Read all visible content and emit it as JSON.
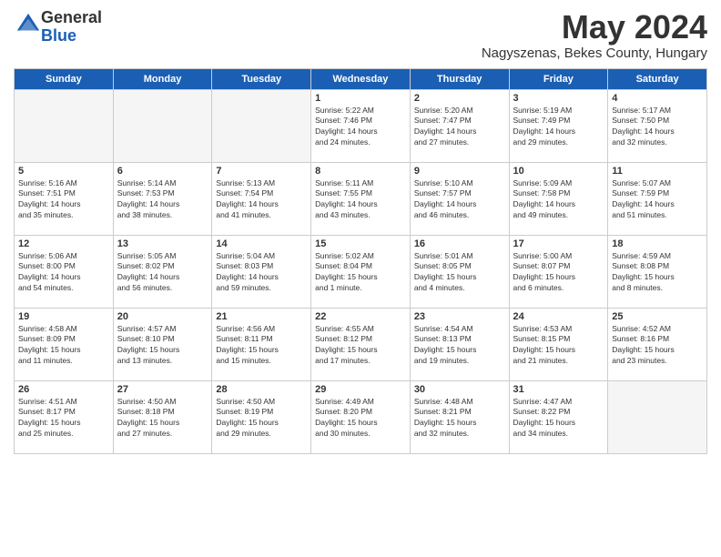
{
  "logo": {
    "general": "General",
    "blue": "Blue"
  },
  "header": {
    "month": "May 2024",
    "location": "Nagyszenas, Bekes County, Hungary"
  },
  "weekdays": [
    "Sunday",
    "Monday",
    "Tuesday",
    "Wednesday",
    "Thursday",
    "Friday",
    "Saturday"
  ],
  "weeks": [
    [
      {
        "day": "",
        "info": ""
      },
      {
        "day": "",
        "info": ""
      },
      {
        "day": "",
        "info": ""
      },
      {
        "day": "1",
        "info": "Sunrise: 5:22 AM\nSunset: 7:46 PM\nDaylight: 14 hours\nand 24 minutes."
      },
      {
        "day": "2",
        "info": "Sunrise: 5:20 AM\nSunset: 7:47 PM\nDaylight: 14 hours\nand 27 minutes."
      },
      {
        "day": "3",
        "info": "Sunrise: 5:19 AM\nSunset: 7:49 PM\nDaylight: 14 hours\nand 29 minutes."
      },
      {
        "day": "4",
        "info": "Sunrise: 5:17 AM\nSunset: 7:50 PM\nDaylight: 14 hours\nand 32 minutes."
      }
    ],
    [
      {
        "day": "5",
        "info": "Sunrise: 5:16 AM\nSunset: 7:51 PM\nDaylight: 14 hours\nand 35 minutes."
      },
      {
        "day": "6",
        "info": "Sunrise: 5:14 AM\nSunset: 7:53 PM\nDaylight: 14 hours\nand 38 minutes."
      },
      {
        "day": "7",
        "info": "Sunrise: 5:13 AM\nSunset: 7:54 PM\nDaylight: 14 hours\nand 41 minutes."
      },
      {
        "day": "8",
        "info": "Sunrise: 5:11 AM\nSunset: 7:55 PM\nDaylight: 14 hours\nand 43 minutes."
      },
      {
        "day": "9",
        "info": "Sunrise: 5:10 AM\nSunset: 7:57 PM\nDaylight: 14 hours\nand 46 minutes."
      },
      {
        "day": "10",
        "info": "Sunrise: 5:09 AM\nSunset: 7:58 PM\nDaylight: 14 hours\nand 49 minutes."
      },
      {
        "day": "11",
        "info": "Sunrise: 5:07 AM\nSunset: 7:59 PM\nDaylight: 14 hours\nand 51 minutes."
      }
    ],
    [
      {
        "day": "12",
        "info": "Sunrise: 5:06 AM\nSunset: 8:00 PM\nDaylight: 14 hours\nand 54 minutes."
      },
      {
        "day": "13",
        "info": "Sunrise: 5:05 AM\nSunset: 8:02 PM\nDaylight: 14 hours\nand 56 minutes."
      },
      {
        "day": "14",
        "info": "Sunrise: 5:04 AM\nSunset: 8:03 PM\nDaylight: 14 hours\nand 59 minutes."
      },
      {
        "day": "15",
        "info": "Sunrise: 5:02 AM\nSunset: 8:04 PM\nDaylight: 15 hours\nand 1 minute."
      },
      {
        "day": "16",
        "info": "Sunrise: 5:01 AM\nSunset: 8:05 PM\nDaylight: 15 hours\nand 4 minutes."
      },
      {
        "day": "17",
        "info": "Sunrise: 5:00 AM\nSunset: 8:07 PM\nDaylight: 15 hours\nand 6 minutes."
      },
      {
        "day": "18",
        "info": "Sunrise: 4:59 AM\nSunset: 8:08 PM\nDaylight: 15 hours\nand 8 minutes."
      }
    ],
    [
      {
        "day": "19",
        "info": "Sunrise: 4:58 AM\nSunset: 8:09 PM\nDaylight: 15 hours\nand 11 minutes."
      },
      {
        "day": "20",
        "info": "Sunrise: 4:57 AM\nSunset: 8:10 PM\nDaylight: 15 hours\nand 13 minutes."
      },
      {
        "day": "21",
        "info": "Sunrise: 4:56 AM\nSunset: 8:11 PM\nDaylight: 15 hours\nand 15 minutes."
      },
      {
        "day": "22",
        "info": "Sunrise: 4:55 AM\nSunset: 8:12 PM\nDaylight: 15 hours\nand 17 minutes."
      },
      {
        "day": "23",
        "info": "Sunrise: 4:54 AM\nSunset: 8:13 PM\nDaylight: 15 hours\nand 19 minutes."
      },
      {
        "day": "24",
        "info": "Sunrise: 4:53 AM\nSunset: 8:15 PM\nDaylight: 15 hours\nand 21 minutes."
      },
      {
        "day": "25",
        "info": "Sunrise: 4:52 AM\nSunset: 8:16 PM\nDaylight: 15 hours\nand 23 minutes."
      }
    ],
    [
      {
        "day": "26",
        "info": "Sunrise: 4:51 AM\nSunset: 8:17 PM\nDaylight: 15 hours\nand 25 minutes."
      },
      {
        "day": "27",
        "info": "Sunrise: 4:50 AM\nSunset: 8:18 PM\nDaylight: 15 hours\nand 27 minutes."
      },
      {
        "day": "28",
        "info": "Sunrise: 4:50 AM\nSunset: 8:19 PM\nDaylight: 15 hours\nand 29 minutes."
      },
      {
        "day": "29",
        "info": "Sunrise: 4:49 AM\nSunset: 8:20 PM\nDaylight: 15 hours\nand 30 minutes."
      },
      {
        "day": "30",
        "info": "Sunrise: 4:48 AM\nSunset: 8:21 PM\nDaylight: 15 hours\nand 32 minutes."
      },
      {
        "day": "31",
        "info": "Sunrise: 4:47 AM\nSunset: 8:22 PM\nDaylight: 15 hours\nand 34 minutes."
      },
      {
        "day": "",
        "info": ""
      }
    ]
  ]
}
